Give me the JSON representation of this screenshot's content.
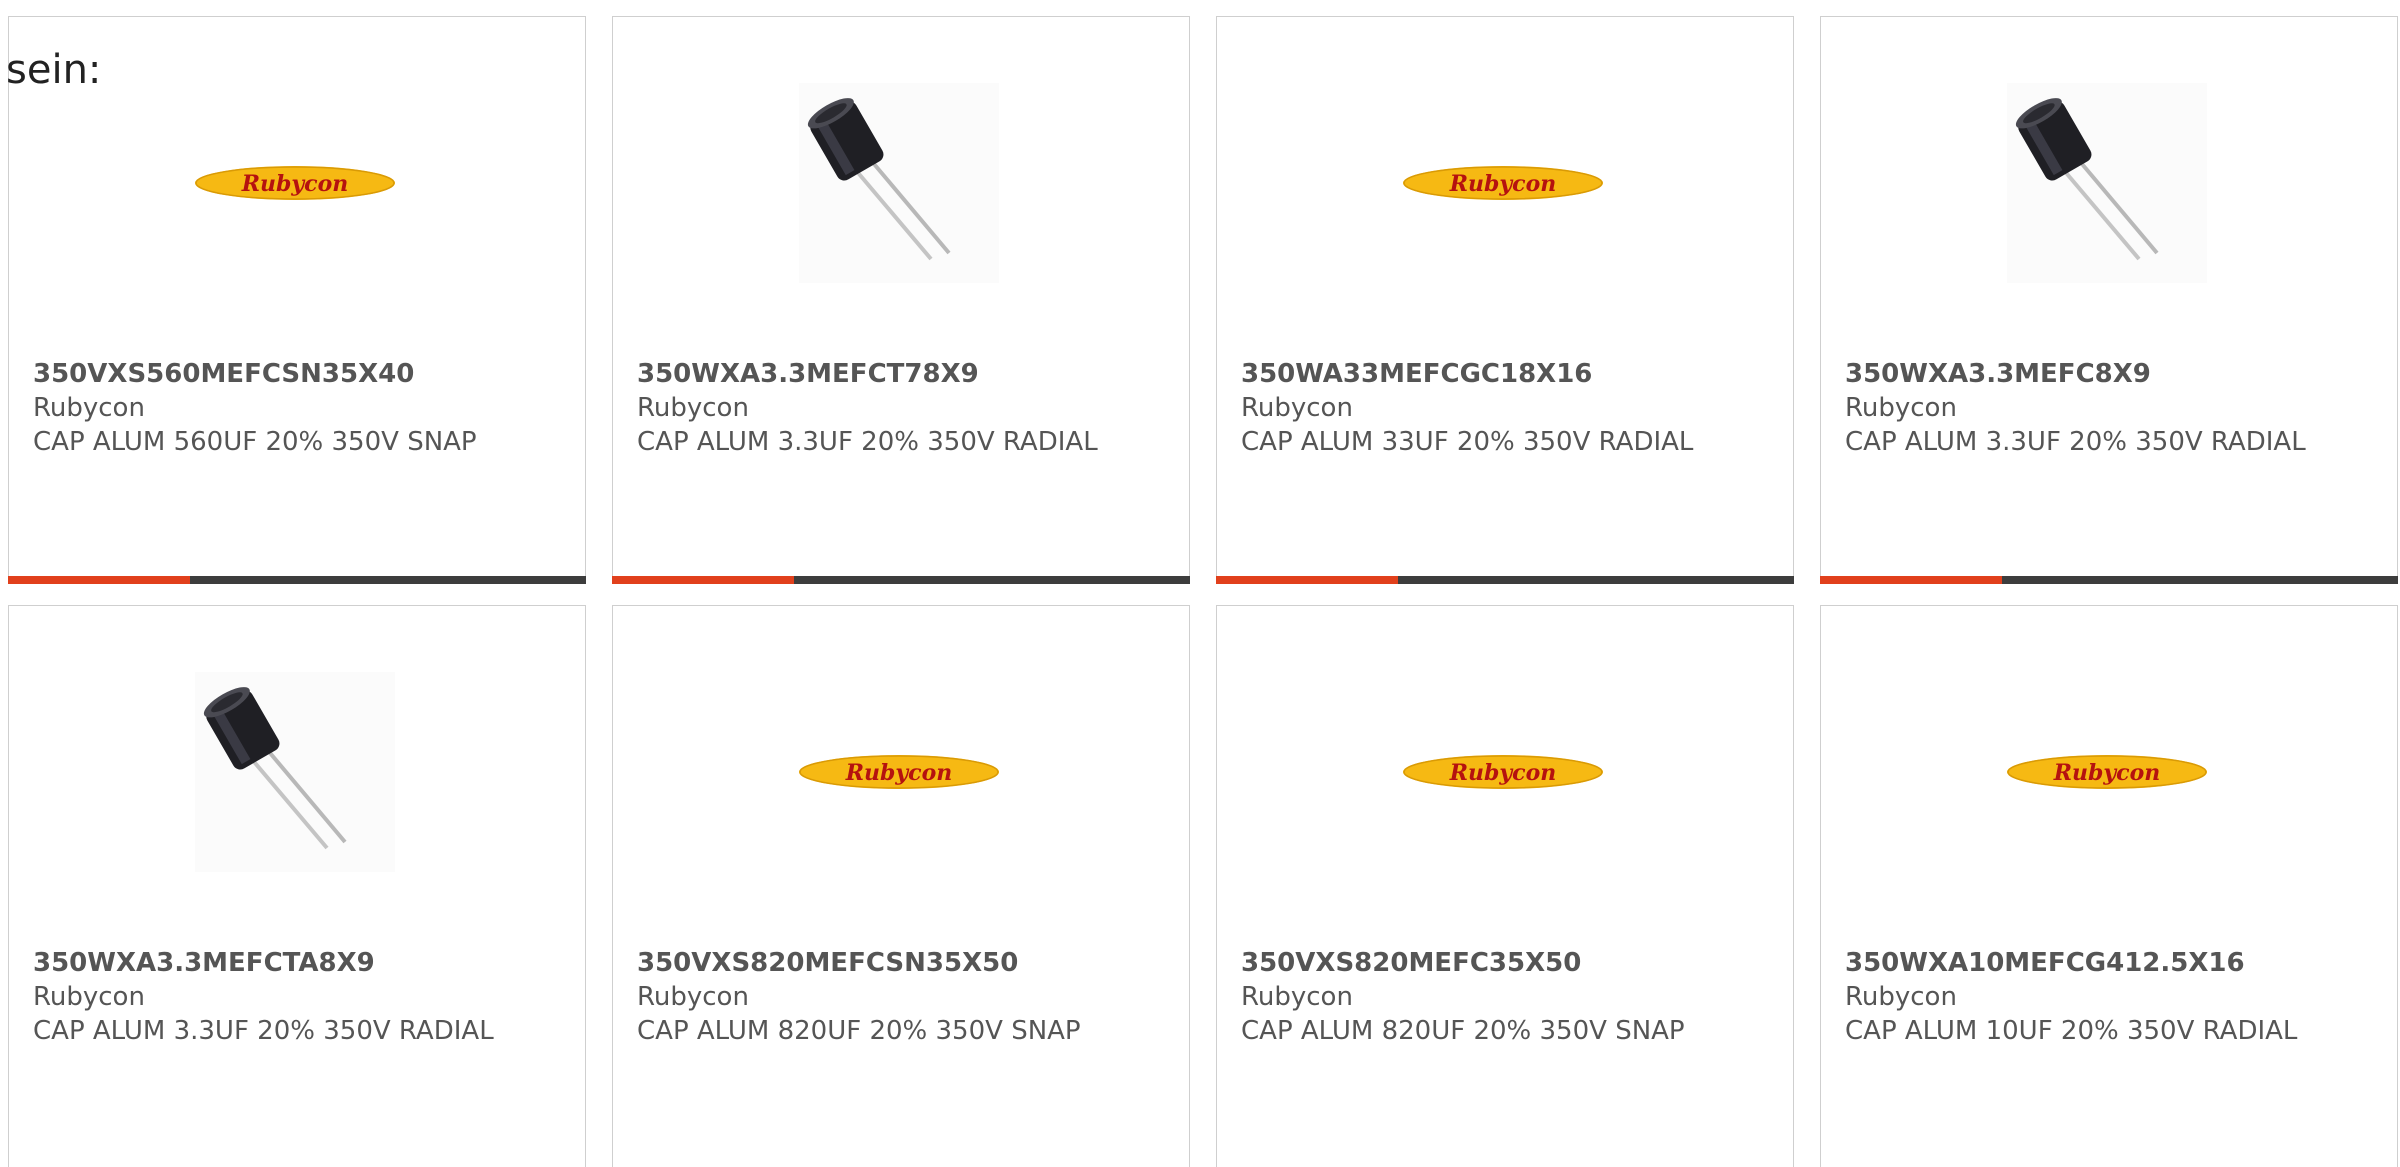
{
  "intro_text": "sein:",
  "colors": {
    "accent": "#e1401c",
    "bar_dark": "#3d3d3d",
    "logo_yellow": "#f6b913",
    "logo_text": "#b5120f"
  },
  "products": [
    {
      "part_number": "350VXS560MEFCSN35X40",
      "manufacturer": "Rubycon",
      "description": "CAP ALUM 560UF 20% 350V SNAP",
      "image": "rubycon-logo"
    },
    {
      "part_number": "350WXA3.3MEFCT78X9",
      "manufacturer": "Rubycon",
      "description": "CAP ALUM 3.3UF 20% 350V RADIAL",
      "image": "radial-capacitor-photo"
    },
    {
      "part_number": "350WA33MEFCGC18X16",
      "manufacturer": "Rubycon",
      "description": "CAP ALUM 33UF 20% 350V RADIAL",
      "image": "rubycon-logo"
    },
    {
      "part_number": "350WXA3.3MEFC8X9",
      "manufacturer": "Rubycon",
      "description": "CAP ALUM 3.3UF 20% 350V RADIAL",
      "image": "radial-capacitor-photo"
    },
    {
      "part_number": "350WXA3.3MEFCTA8X9",
      "manufacturer": "Rubycon",
      "description": "CAP ALUM 3.3UF 20% 350V RADIAL",
      "image": "radial-capacitor-photo"
    },
    {
      "part_number": "350VXS820MEFCSN35X50",
      "manufacturer": "Rubycon",
      "description": "CAP ALUM 820UF 20% 350V SNAP",
      "image": "rubycon-logo"
    },
    {
      "part_number": "350VXS820MEFC35X50",
      "manufacturer": "Rubycon",
      "description": "CAP ALUM 820UF 20% 350V SNAP",
      "image": "rubycon-logo"
    },
    {
      "part_number": "350WXA10MEFCG412.5X16",
      "manufacturer": "Rubycon",
      "description": "CAP ALUM 10UF 20% 350V RADIAL",
      "image": "rubycon-logo"
    }
  ]
}
